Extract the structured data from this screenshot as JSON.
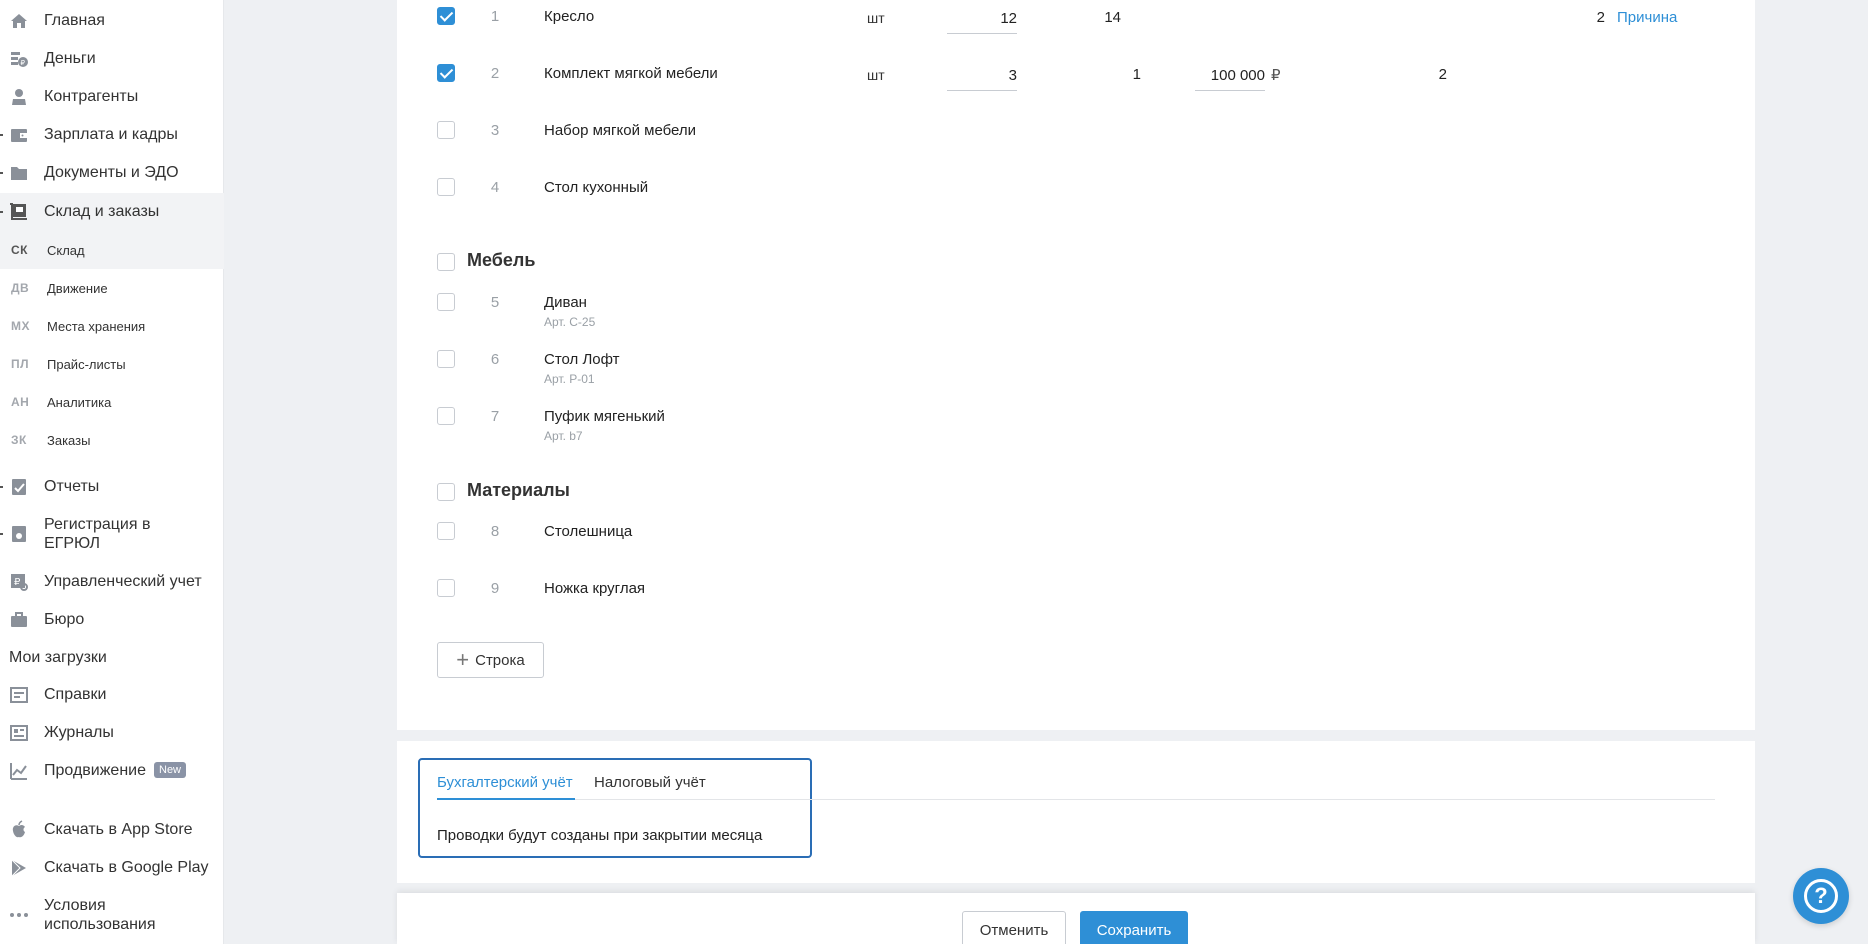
{
  "sidebar": {
    "items": [
      {
        "label": "Главная",
        "icon": "home-icon"
      },
      {
        "label": "Деньги",
        "icon": "money-icon"
      },
      {
        "label": "Контрагенты",
        "icon": "contractors-icon"
      },
      {
        "label": "Зарплата и кадры",
        "icon": "wallet-icon"
      },
      {
        "label": "Документы и ЭДО",
        "icon": "folder-icon"
      },
      {
        "label": "Склад и заказы",
        "icon": "warehouse-icon"
      }
    ],
    "sub_items": [
      {
        "abbr": "СК",
        "label": "Склад"
      },
      {
        "abbr": "ДВ",
        "label": "Движение"
      },
      {
        "abbr": "МХ",
        "label": "Места хранения"
      },
      {
        "abbr": "ПЛ",
        "label": "Прайс-листы"
      },
      {
        "abbr": "АН",
        "label": "Аналитика"
      },
      {
        "abbr": "ЗК",
        "label": "Заказы"
      }
    ],
    "items2": [
      {
        "label": "Отчеты",
        "icon": "reports-icon"
      },
      {
        "label": "Регистрация в ЕГРЮЛ",
        "icon": "registration-icon"
      },
      {
        "label": "Управленческий учет",
        "icon": "management-icon"
      },
      {
        "label": "Бюро",
        "icon": "briefcase-icon"
      }
    ],
    "downloads": "Мои загрузки",
    "items3": [
      {
        "label": "Справки",
        "icon": "references-icon"
      },
      {
        "label": "Журналы",
        "icon": "journals-icon"
      },
      {
        "label": "Продвижение",
        "icon": "promotion-icon",
        "badge": "New"
      }
    ],
    "items4": [
      {
        "label": "Скачать в App Store",
        "icon": "apple-icon"
      },
      {
        "label": "Скачать в Google Play",
        "icon": "google-play-icon"
      },
      {
        "label": "Условия использования",
        "icon": "more-icon"
      }
    ]
  },
  "table": {
    "rows": [
      {
        "num": "1",
        "name": "Кресло",
        "unit": "шт",
        "qty": "12",
        "fact": "14",
        "diff": "2",
        "reason": "Причина",
        "checked": true
      },
      {
        "num": "2",
        "name": "Комплект мягкой мебели",
        "unit": "шт",
        "qty": "3",
        "fact": "1",
        "price": "100 000",
        "currency": "₽",
        "diff": "2",
        "checked": true
      },
      {
        "num": "3",
        "name": "Набор мягкой мебели",
        "checked": false
      },
      {
        "num": "4",
        "name": "Стол кухонный",
        "checked": false
      }
    ],
    "groups": [
      {
        "title": "Мебель",
        "rows": [
          {
            "num": "5",
            "name": "Диван",
            "art": "Арт. С-25"
          },
          {
            "num": "6",
            "name": "Стол Лофт",
            "art": "Арт. Р-01"
          },
          {
            "num": "7",
            "name": "Пуфик мягенький",
            "art": "Арт. b7"
          }
        ]
      },
      {
        "title": "Материалы",
        "rows": [
          {
            "num": "8",
            "name": "Столешница"
          },
          {
            "num": "9",
            "name": "Ножка круглая"
          }
        ]
      }
    ],
    "add_row_label": "Строка"
  },
  "accounting": {
    "tabs": [
      "Бухгалтерский учёт",
      "Налоговый учёт"
    ],
    "text": "Проводки будут созданы при закрытии месяца"
  },
  "footer": {
    "cancel_label": "Отменить",
    "save_label": "Сохранить"
  },
  "help_label": "?",
  "colors": {
    "accent": "#2e8fd6",
    "focus_border": "#2a6db5"
  }
}
